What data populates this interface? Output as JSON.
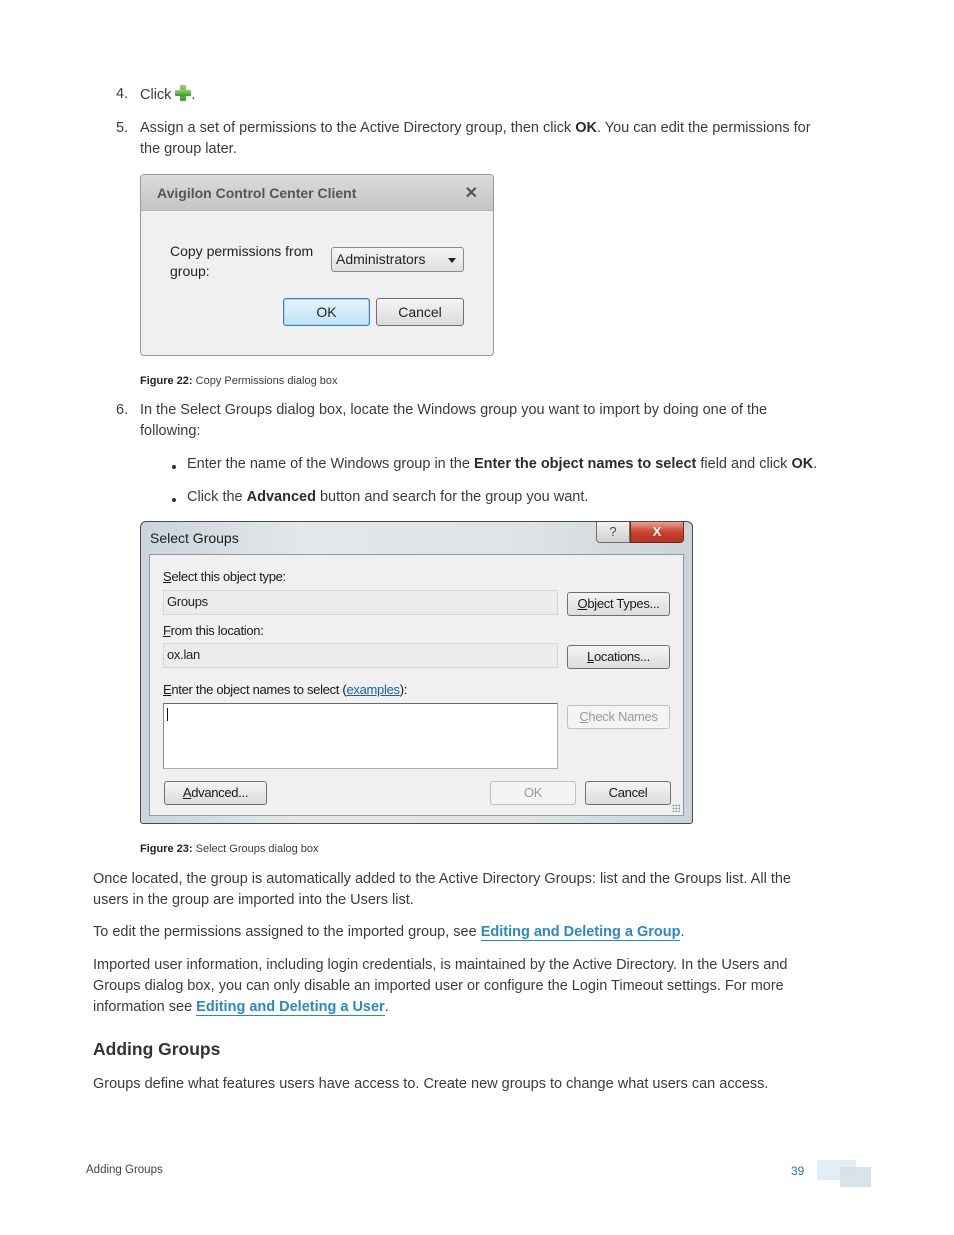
{
  "steps": {
    "step4": {
      "number": "4.",
      "text": "Click",
      "icon": "green-plus-icon",
      "after": "."
    },
    "step5": {
      "number": "5.",
      "text_before": "Assign a set of permissions to the Active Directory group, then click ",
      "bold": "OK",
      "text_after_line1": ". You can edit the permissions for",
      "text_line2": "the group later."
    },
    "step6": {
      "number": "6.",
      "line1": "In the Select Groups dialog box, locate the Windows group you want to import by doing one of the",
      "line2": "following:",
      "bullets": [
        {
          "pre": "Enter the name of the Windows group in the ",
          "bold": "Enter the object names to select",
          "mid": " field and click ",
          "bold2": "OK",
          "post": "."
        },
        {
          "pre": "Click the ",
          "bold": "Advanced",
          "post": " button and search for the group you want."
        }
      ]
    }
  },
  "copy_dialog": {
    "title": "Avigilon Control Center Client",
    "close_icon": "close-x-icon",
    "label_line1": "Copy permissions from",
    "label_line2": "group:",
    "select_value": "Administrators",
    "ok": "OK",
    "cancel": "Cancel"
  },
  "figure22": {
    "label": "Figure 22:",
    "text": " Copy Permissions dialog box"
  },
  "select_dialog": {
    "title": "Select Groups",
    "help": "?",
    "close": "X",
    "object_type_label_u": "S",
    "object_type_label_rest": "elect this object type:",
    "object_type_value": "Groups",
    "object_types_btn_u": "O",
    "object_types_btn_rest": "bject Types...",
    "location_label_u": "F",
    "location_label_rest": "rom this location:",
    "location_value": "ox.lan",
    "locations_btn_u": "L",
    "locations_btn_rest": "ocations...",
    "names_label_u": "E",
    "names_label_rest": "nter the object names to select (",
    "names_label_link": "examples",
    "names_label_end": "):",
    "names_value": "",
    "check_names_u": "C",
    "check_names_rest": "heck Names",
    "advanced_u": "A",
    "advanced_rest": "dvanced...",
    "ok": "OK",
    "cancel": "Cancel"
  },
  "figure23": {
    "label": "Figure 23:",
    "text": " Select Groups dialog box"
  },
  "paragraphs": {
    "p1_line1": "Once located, the group is automatically added to the Active Directory Groups: list and the Groups list. All the",
    "p1_line2": "users in the group are imported into the Users list.",
    "p2_pre": "To edit the permissions assigned to the imported group, see ",
    "p2_link": "Editing and Deleting a Group",
    "p2_post": ".",
    "p3_line1": "Imported user information, including login credentials, is maintained by the Active Directory. In the Users and",
    "p3_line2": "Groups dialog box, you can only disable an imported user or configure the Login Timeout settings. For more",
    "p3_line3_pre": "information see ",
    "p3_link": "Editing and Deleting a User",
    "p3_post": "."
  },
  "section": {
    "heading": "Adding Groups",
    "text": "Groups define what features users have access to. Create new groups to change what users can access."
  },
  "footer": {
    "section_name": "Adding Groups",
    "page_number": "39"
  }
}
